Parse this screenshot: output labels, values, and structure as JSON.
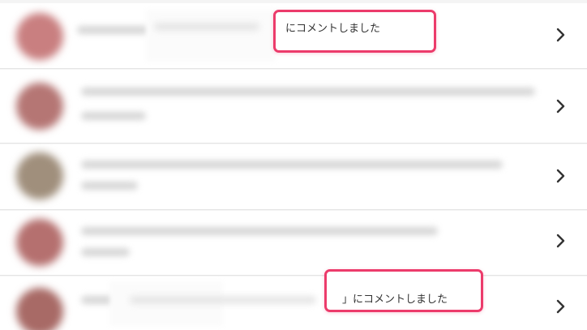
{
  "notifications": [
    {
      "text": "にコメントしました",
      "avatar_color": "#c97f80"
    },
    {
      "text": "",
      "avatar_color": "#b57674"
    },
    {
      "text": "",
      "avatar_color": "#a08f7c"
    },
    {
      "text": "",
      "avatar_color": "#b5706f"
    },
    {
      "text": "」にコメントしました",
      "avatar_color": "#a86a66"
    }
  ],
  "colors": {
    "highlight": "#ec3b6b",
    "chevron": "#333333"
  },
  "icons": {
    "row_arrow": "chevron-right-icon"
  }
}
